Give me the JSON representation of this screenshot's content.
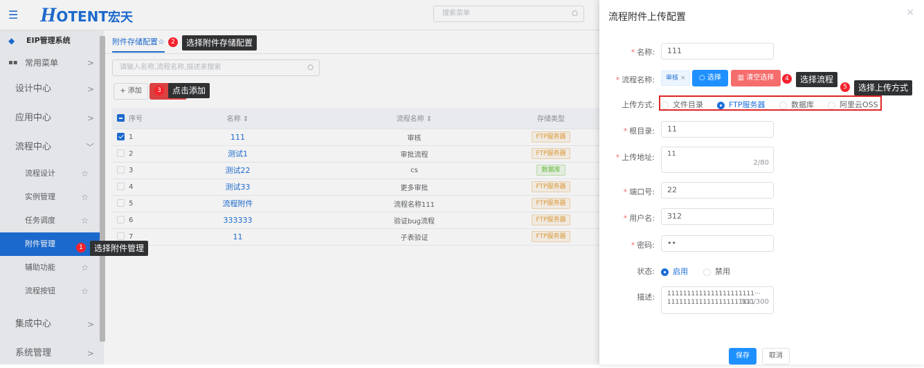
{
  "header": {
    "logo_h": "H",
    "logo_text": "OTENT",
    "logo_cn": "宏天",
    "menu_search_placeholder": "搜索菜单"
  },
  "sidebar": {
    "system": "EIP管理系统",
    "items": [
      {
        "label": "常用菜单"
      },
      {
        "label": "设计中心"
      },
      {
        "label": "应用中心"
      },
      {
        "label": "流程中心"
      }
    ],
    "sub_items": [
      {
        "label": "流程设计"
      },
      {
        "label": "实例管理"
      },
      {
        "label": "任务调度"
      },
      {
        "label": "附件管理"
      },
      {
        "label": "辅助功能"
      },
      {
        "label": "流程按钮"
      }
    ],
    "bottom_items": [
      {
        "label": "集成中心"
      },
      {
        "label": "系统管理"
      }
    ]
  },
  "main": {
    "tab": "附件存储配置",
    "search_placeholder": "请输入名称,流程名称,描述来搜索",
    "add_label": "+ 添加",
    "columns": [
      "序号",
      "名称 ⇕",
      "流程名称 ⇕",
      "存储类型"
    ],
    "rows": [
      {
        "no": "1",
        "name": "111",
        "flow": "审核",
        "type": "FTP服务器",
        "kind": "ftp"
      },
      {
        "no": "2",
        "name": "测试1",
        "flow": "审批流程",
        "type": "FTP服务器",
        "kind": "ftp"
      },
      {
        "no": "3",
        "name": "测试22",
        "flow": "cs",
        "type": "数据库",
        "kind": "db"
      },
      {
        "no": "4",
        "name": "测试33",
        "flow": "更多审批",
        "type": "FTP服务器",
        "kind": "ftp"
      },
      {
        "no": "5",
        "name": "流程附件",
        "flow": "流程名称111",
        "type": "FTP服务器",
        "kind": "ftp"
      },
      {
        "no": "6",
        "name": "333333",
        "flow": "验证bug流程",
        "type": "FTP服务器",
        "kind": "ftp"
      },
      {
        "no": "7",
        "name": "11",
        "flow": "子表验证",
        "type": "FTP服务器",
        "kind": "ftp"
      }
    ]
  },
  "callouts": {
    "c1": {
      "num": "1",
      "text": "选择附件管理"
    },
    "c2": {
      "num": "2",
      "text": "选择附件存储配置"
    },
    "c3": {
      "num": "3",
      "text": "点击添加"
    },
    "c4": {
      "num": "4",
      "text": "选择流程"
    },
    "c5": {
      "num": "5",
      "text": "选择上传方式"
    }
  },
  "dialog": {
    "title": "流程附件上传配置",
    "close": "×",
    "name_label": "名称:",
    "name_value": "111",
    "flow_label": "流程名称:",
    "flow_tag": "审核",
    "select_btn": "选择",
    "clear_btn": "清空选择",
    "upload_label": "上传方式:",
    "upload_options": [
      "文件目录",
      "FTP服务器",
      "数据库",
      "阿里云OSS"
    ],
    "root_label": "根目录:",
    "root_value": "11",
    "addr_label": "上传地址:",
    "addr_value": "11",
    "addr_count": "2/80",
    "port_label": "端口号:",
    "port_value": "22",
    "user_label": "用户名:",
    "user_value": "312",
    "pwd_label": "密码:",
    "pwd_value": "••",
    "status_label": "状态:",
    "status_on": "启用",
    "status_off": "禁用",
    "desc_label": "描述:",
    "desc_line1": "1111111111111111111111···",
    "desc_line2": "1111111111111111111111",
    "desc_count": "300/300",
    "save_btn": "保存",
    "cancel_btn": "取消"
  },
  "colors": {
    "accent": "#1e6fd9",
    "danger": "#e64545",
    "callout": "#303133"
  }
}
